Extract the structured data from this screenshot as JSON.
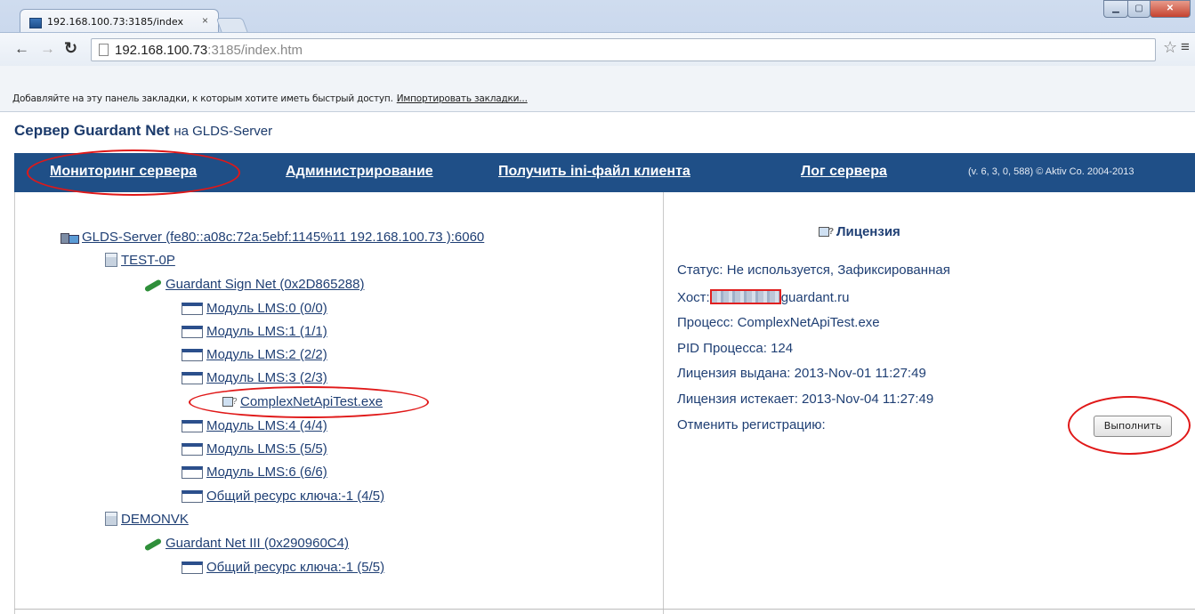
{
  "browser": {
    "tab_title": "192.168.100.73:3185/index",
    "tab_close": "×",
    "url_host": "192.168.100.73",
    "url_rest": ":3185/index.htm",
    "bookmarks_text": "Добавляйте на эту панель закладки, к которым хотите иметь быстрый доступ.",
    "bookmarks_link": "Импортировать закладки..."
  },
  "page": {
    "title_bold": "Сервер Guardant Net",
    "title_rest": "на GLDS-Server"
  },
  "nav": {
    "items": [
      "Мониторинг сервера",
      "Администрирование",
      "Получить ini-файл клиента",
      "Лог сервера"
    ],
    "version": "(v. 6, 3, 0, 588) © Aktiv Co. 2004-2013"
  },
  "tree": {
    "server": "GLDS-Server (fe80::a08c:72a:5ebf:1145%11 192.168.100.73 ):6060",
    "hosts": [
      {
        "name": "TEST-0P",
        "key": "Guardant Sign Net (0x2D865288)",
        "modules": [
          "Модуль LMS:0 (0/0)",
          "Модуль LMS:1 (1/1)",
          "Модуль LMS:2 (2/2)",
          "Модуль LMS:3 (2/3)",
          "ComplexNetApiTest.exe",
          "Модуль LMS:4 (4/4)",
          "Модуль LMS:5 (5/5)",
          "Модуль LMS:6 (6/6)",
          "Общий ресурс ключа:-1 (4/5)"
        ]
      },
      {
        "name": "DEMONVK",
        "key": "Guardant Net III (0x290960C4)",
        "modules": [
          "Общий ресурс ключа:-1 (5/5)"
        ]
      }
    ]
  },
  "license": {
    "title": "Лицензия",
    "status": "Статус: Не используется, Зафиксированная",
    "host_label": "Хост:",
    "host_suffix": "guardant.ru",
    "process": "Процесс: ComplexNetApiTest.exe",
    "pid": "PID Процесса: 124",
    "issued": "Лицензия выдана: 2013-Nov-01 11:27:49",
    "expires": "Лицензия истекает: 2013-Nov-04 11:27:49",
    "unregister_label": "Отменить регистрацию:",
    "run_button": "Выполнить"
  },
  "colors": {
    "navbar": "#1f4f87",
    "link": "#1f3f74",
    "annotation": "#e01818"
  }
}
